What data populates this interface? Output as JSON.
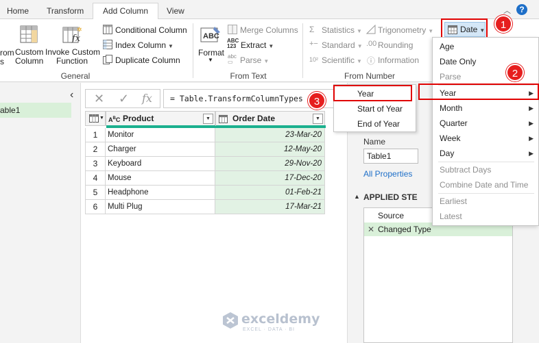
{
  "tabs": [
    "Home",
    "Transform",
    "Add Column",
    "View"
  ],
  "ribbon": {
    "general": {
      "cut_from": "rom",
      "cut_from2": "s",
      "custom_column": [
        "Custom",
        "Column"
      ],
      "invoke_custom_function": [
        "Invoke Custom",
        "Function"
      ],
      "conditional_column": "Conditional Column",
      "index_column": "Index Column",
      "duplicate_column": "Duplicate Column",
      "label": "General"
    },
    "from_text": {
      "format": "Format",
      "merge_columns": "Merge Columns",
      "extract": "Extract",
      "parse": "Parse",
      "label": "From Text"
    },
    "from_number": {
      "statistics": "Statistics",
      "standard": "Standard",
      "scientific": "Scientific",
      "trigonometry": "Trigonometry",
      "rounding": "Rounding",
      "information": "Information",
      "label": "From Number"
    },
    "date_button": "Date"
  },
  "left_pane": {
    "query_name": "able1"
  },
  "formula_bar": {
    "fx": "fx",
    "formula": "= Table.TransformColumnTypes"
  },
  "table": {
    "columns": [
      {
        "type_badge": "ABC",
        "name": "Product"
      },
      {
        "type_badge": "calendar",
        "name": "Order Date"
      }
    ],
    "rows": [
      {
        "num": "1",
        "product": "Monitor",
        "date": "23-Mar-20"
      },
      {
        "num": "2",
        "product": "Charger",
        "date": "12-May-20"
      },
      {
        "num": "3",
        "product": "Keyboard",
        "date": "29-Nov-20"
      },
      {
        "num": "4",
        "product": "Mouse",
        "date": "17-Dec-20"
      },
      {
        "num": "5",
        "product": "Headphone",
        "date": "01-Feb-21"
      },
      {
        "num": "6",
        "product": "Multi Plug",
        "date": "17-Mar-21"
      }
    ]
  },
  "year_submenu": [
    "Year",
    "Start of Year",
    "End of Year"
  ],
  "date_menu": {
    "items": [
      {
        "label": "Age",
        "enabled": true,
        "submenu": false
      },
      {
        "label": "Date Only",
        "enabled": true,
        "submenu": false
      },
      {
        "label": "Parse",
        "enabled": false,
        "submenu": false
      },
      {
        "label": "Year",
        "enabled": true,
        "submenu": true
      },
      {
        "label": "Month",
        "enabled": true,
        "submenu": true
      },
      {
        "label": "Quarter",
        "enabled": true,
        "submenu": true
      },
      {
        "label": "Week",
        "enabled": true,
        "submenu": true
      },
      {
        "label": "Day",
        "enabled": true,
        "submenu": true
      },
      {
        "label": "Subtract Days",
        "enabled": false,
        "submenu": false
      },
      {
        "label": "Combine Date and Time",
        "enabled": false,
        "submenu": false
      },
      {
        "label": "Earliest",
        "enabled": false,
        "submenu": false
      },
      {
        "label": "Latest",
        "enabled": false,
        "submenu": false
      }
    ]
  },
  "query_settings": {
    "name_label": "Name",
    "name_value": "Table1",
    "all_properties": "All Properties",
    "applied_steps": "APPLIED STE",
    "steps": [
      "Source",
      "Changed Type"
    ]
  },
  "callouts": [
    "1",
    "2",
    "3"
  ],
  "watermark": {
    "name": "exceldemy",
    "tagline": "EXCEL · DATA · BI"
  },
  "colors": {
    "highlight": "#e00000",
    "accent_green": "#1bb08e",
    "selection": "#d9f0d9",
    "link": "#1e6fc8"
  }
}
